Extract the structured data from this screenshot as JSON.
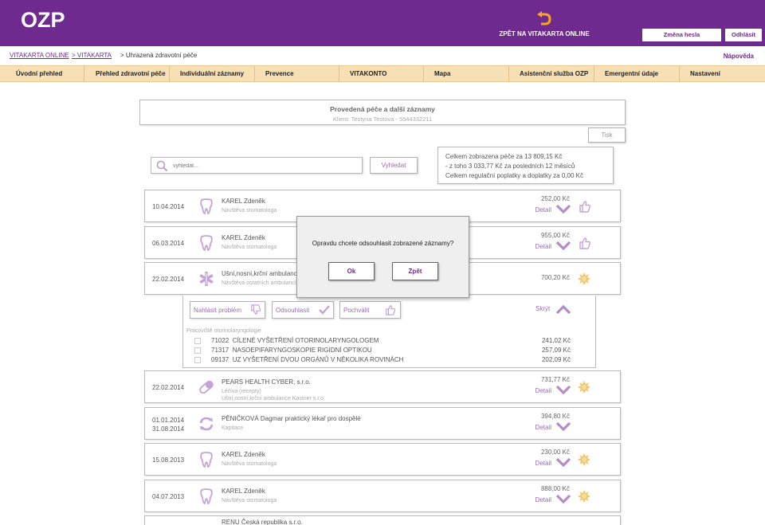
{
  "header": {
    "logo": "OZP",
    "back_label": "ZPĚT NA VITAKARTA ONLINE",
    "change_password": "Změna hesla",
    "logout": "Odhlásit"
  },
  "breadcrumb": {
    "items": [
      "VITAKARTA ONLINE",
      "> VITAKARTA",
      "> Uhrazená zdravotní péče"
    ],
    "help": "Nápověda"
  },
  "nav": [
    "Úvodní přehled",
    "Přehled zdravotní péče",
    "Individuální záznamy",
    "Prevence",
    "VITAKONTO",
    "Mapa",
    "Asistenční služba OZP",
    "Emergentní údaje",
    "Nastavení"
  ],
  "main": {
    "title": "Provedená péče a další záznamy",
    "client": "Klient: Testyna Testova - 5544332211",
    "print": "Tisk",
    "search_placeholder": "vyhledat...",
    "search_button": "Vyhledat",
    "summary": [
      "Celkem zobrazena péče za  13 809,15 Kč",
      "- z toho  3 033,77 Kč  za posledních 12 měsíců",
      "Celkem regulační poplatky a doplatky za  0,00 Kč"
    ]
  },
  "detail_label": "Detail",
  "records": [
    {
      "date": "10.04.2014",
      "name": "KAREL Zdeněk",
      "sub": "Návštěva stomatologa",
      "amount": "252,00 Kč"
    },
    {
      "date": "06.03.2014",
      "name": "KAREL Zdeněk",
      "sub": "Návštěva stomatologa",
      "amount": "955,00 Kč"
    },
    {
      "date": "22.02.2014",
      "name": "Ušní,nosní,krční ambulance",
      "sub": "Návštěva ostatních ambulancí",
      "amount": "700,20 Kč"
    },
    {
      "date": "22.02.2014",
      "name": "PEARS HEALTH CYBER, s.r.o.",
      "sub": "Léčiva (recepty)",
      "sub2": "Ušní,nosní,krční ambulance Kastner s.r.o.",
      "amount": "731,77 Kč"
    },
    {
      "date": "01.01.2014",
      "date2": "31.08.2014",
      "name": "PĚNIČKOVÁ Dagmar praktický lékař pro dospělé",
      "sub": "Kapitace",
      "amount": "394,80 Kč"
    },
    {
      "date": "15.08.2013",
      "name": "KAREL Zdeněk",
      "sub": "Návštěva stomatologa",
      "amount": "230,00 Kč"
    },
    {
      "date": "04.07.2013",
      "name": "KAREL Zdeněk",
      "sub": "Návštěva stomatologa",
      "amount": "888,00 Kč"
    },
    {
      "name": "RENU Česká republika s.r.o."
    }
  ],
  "expanded": {
    "report_problem": "Nahlásit problém",
    "approve": "Odsouhlasit",
    "praise": "Pochválit",
    "hide": "Skrýt",
    "workplace": "Pracoviště otorinolaryngologie",
    "items": [
      {
        "code": "71022",
        "text": "CÍLENÉ VYŠETŘENÍ OTORINOLARYNGOLOGEM",
        "price": "241,02 Kč"
      },
      {
        "code": "71317",
        "text": "NASOEPIFARYNGOSKOPIE RIGIDNÍ OPTIKOU",
        "price": "257,09 Kč"
      },
      {
        "code": "09137",
        "text": "UZ VYŠETŘENÍ DVOU ORGÁNŮ V NĚKOLIKA ROVINÁCH",
        "price": "202,09 Kč"
      }
    ]
  },
  "dialog": {
    "question": "Opravdu chcete odsouhlasit zobrazené záznamy?",
    "ok": "Ok",
    "back": "Zpět"
  },
  "colors": {
    "brand": "#6e2a8f",
    "accent": "#9a6cb3",
    "nav_bg": "#f7dfb6",
    "star": "#f0c870"
  }
}
